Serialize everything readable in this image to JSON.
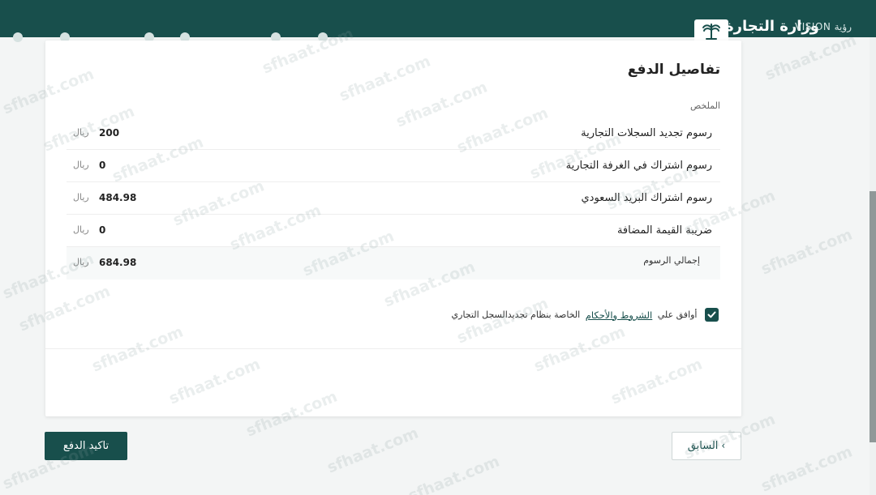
{
  "header": {
    "brand": "وزارة التجارة",
    "vision": "VISION رؤية"
  },
  "payment": {
    "title": "تفاصيل الدفع",
    "summary_label": "الملخص",
    "items": [
      {
        "label": "رسوم تجديد السجلات التجارية",
        "amount": "200",
        "currency": "ريال"
      },
      {
        "label": "رسوم اشتراك في الغرفة التجارية",
        "amount": "0",
        "currency": "ريال"
      },
      {
        "label": "رسوم اشتراك البريد السعودي",
        "amount": "484.98",
        "currency": "ريال"
      },
      {
        "label": "ضريبة القيمة المضافة",
        "amount": "0",
        "currency": "ريال"
      }
    ],
    "total": {
      "label": "إجمالي الرسوم",
      "amount": "684.98",
      "currency": "ريال"
    }
  },
  "terms": {
    "prefix": "أوافق علي",
    "link": "الشروط والأحكام",
    "suffix": "الخاصة بنظام تجديدالسجل التجاري",
    "checked": true
  },
  "actions": {
    "confirm_label": "تاكيد الدفع",
    "back_label": "السابق"
  },
  "watermark": "sfhaat.com",
  "colors": {
    "primary": "#184f4c"
  }
}
